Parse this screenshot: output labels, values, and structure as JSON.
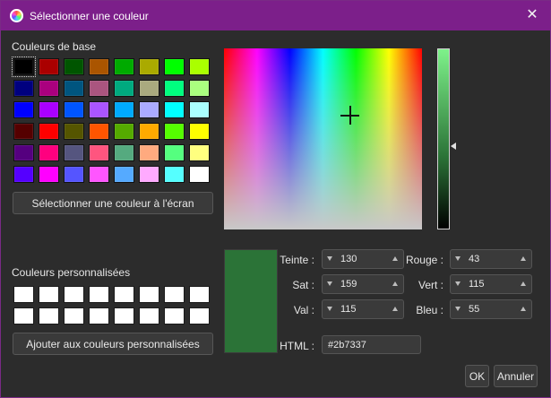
{
  "window": {
    "title": "Sélectionner une couleur",
    "icon": "color-wheel-icon",
    "close_icon": "close-icon",
    "accent": "#7c1f8a"
  },
  "basic_colors": {
    "label": "Couleurs de base",
    "colors": [
      "#000000",
      "#aa0000",
      "#005500",
      "#aa5500",
      "#00aa00",
      "#aaaa00",
      "#00ff00",
      "#aaff00",
      "#00007f",
      "#aa007f",
      "#00557f",
      "#aa557f",
      "#00aa7f",
      "#aaaa7f",
      "#00ff7f",
      "#aaff7f",
      "#0000ff",
      "#aa00ff",
      "#0055ff",
      "#aa55ff",
      "#00aaff",
      "#aaaaff",
      "#00ffff",
      "#aaffff",
      "#550000",
      "#ff0000",
      "#555500",
      "#ff5500",
      "#55aa00",
      "#ffaa00",
      "#55ff00",
      "#ffff00",
      "#55007f",
      "#ff007f",
      "#55557f",
      "#ff557f",
      "#55aa7f",
      "#ffaa7f",
      "#55ff7f",
      "#ffff7f",
      "#5500ff",
      "#ff00ff",
      "#5555ff",
      "#ff55ff",
      "#55aaff",
      "#ffaaff",
      "#55ffff",
      "#ffffff"
    ],
    "pick_screen_button": "Sélectionner une couleur à l'écran"
  },
  "custom_colors": {
    "label": "Couleurs personnalisées",
    "count": 16,
    "add_button": "Ajouter aux couleurs personnalisées"
  },
  "current_color": "#2b7337",
  "fields": {
    "hue": {
      "label": "Teinte :",
      "value": "130"
    },
    "sat": {
      "label": "Sat :",
      "value": "159"
    },
    "val": {
      "label": "Val :",
      "value": "115"
    },
    "red": {
      "label": "Rouge :",
      "value": "43"
    },
    "green": {
      "label": "Vert :",
      "value": "115"
    },
    "blue": {
      "label": "Bleu :",
      "value": "55"
    },
    "html": {
      "label": "HTML :",
      "value": "#2b7337"
    }
  },
  "buttons": {
    "ok": "OK",
    "cancel": "Annuler"
  }
}
